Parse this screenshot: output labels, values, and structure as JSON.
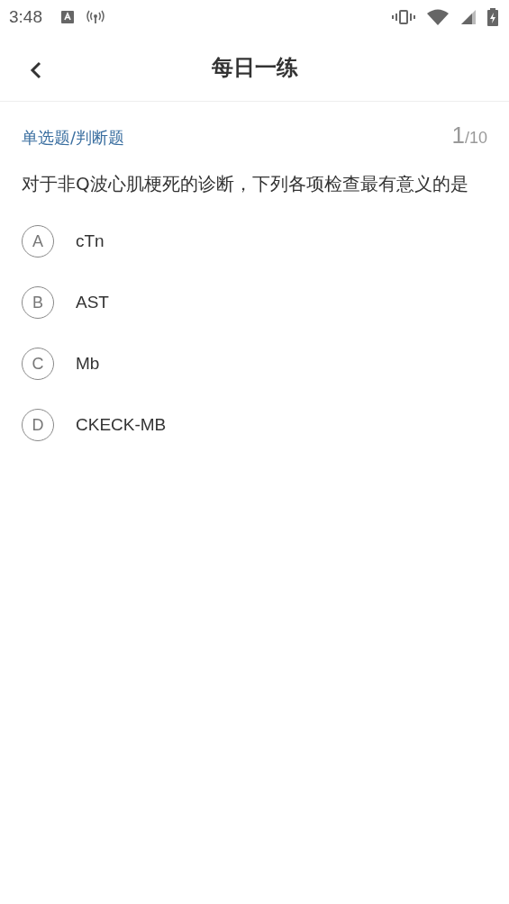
{
  "status_bar": {
    "time": "3:48"
  },
  "header": {
    "title": "每日一练"
  },
  "question": {
    "type": "单选题/判断题",
    "current": "1",
    "total": "/10",
    "text": "对于非Q波心肌梗死的诊断，下列各项检查最有意义的是"
  },
  "options": [
    {
      "letter": "A",
      "text": "cTn",
      "selected": false
    },
    {
      "letter": "B",
      "text": "AST",
      "selected": false
    },
    {
      "letter": "C",
      "text": "Mb",
      "selected": false
    },
    {
      "letter": "D",
      "text": "CKECK-MB",
      "selected": false
    }
  ]
}
